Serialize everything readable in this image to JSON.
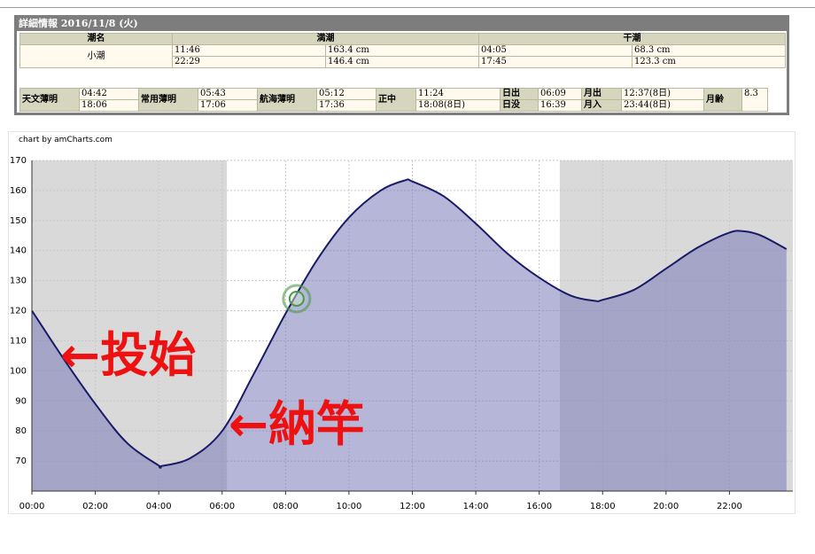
{
  "panel": {
    "title": "詳細情報 2016/11/8 (火)",
    "headers": {
      "name": "潮名",
      "high": "満潮",
      "low": "干潮"
    },
    "tide_name": "小潮",
    "high": [
      {
        "time": "11:46",
        "height": "163.4 cm"
      },
      {
        "time": "22:29",
        "height": "146.4 cm"
      }
    ],
    "low": [
      {
        "time": "04:05",
        "height": "68.3 cm"
      },
      {
        "time": "17:45",
        "height": "123.3 cm"
      }
    ]
  },
  "sun": {
    "astro_label": "天文薄明",
    "astro_start": "04:42",
    "astro_end": "18:06",
    "civil_label": "常用薄明",
    "civil_start": "05:43",
    "civil_end": "17:06",
    "nautical_label": "航海薄明",
    "nautical_start": "05:12",
    "nautical_end": "17:36",
    "noon_label": "正中",
    "noon_time": "11:24",
    "noon_time2": "18:08(8日)",
    "sunrise_label": "日出",
    "sunrise": "06:09",
    "sunset_label": "日没",
    "sunset": "16:39",
    "moonrise_label": "月出",
    "moonrise": "12:37(8日)",
    "moonset_label": "月入",
    "moonset": "23:44(8日)",
    "moonage_label": "月齢",
    "moonage": "8.3"
  },
  "chart_credit": "chart by amCharts.com",
  "annotations": {
    "start": "←投始",
    "end": "←納竿"
  },
  "colors": {
    "night": "#d9d9d9",
    "tide_fill": "#7a7ab8",
    "tide_line": "#1a1a66",
    "annotation": "#ee1111",
    "cursor": "#4a9a4a"
  },
  "chart_data": {
    "type": "area",
    "title": "",
    "xlabel": "",
    "ylabel": "",
    "x_ticks": [
      "00:00",
      "02:00",
      "04:00",
      "06:00",
      "08:00",
      "10:00",
      "12:00",
      "14:00",
      "16:00",
      "18:00",
      "20:00",
      "22:00"
    ],
    "y_ticks": [
      70,
      80,
      90,
      100,
      110,
      120,
      130,
      140,
      150,
      160,
      170
    ],
    "xlim": [
      0,
      24
    ],
    "ylim": [
      60,
      170
    ],
    "series": [
      {
        "x": [
          0,
          1,
          2,
          3,
          4,
          4.083,
          5,
          6,
          7,
          8,
          9,
          10,
          11,
          11.77,
          12,
          13,
          14,
          15,
          16,
          17,
          17.75,
          18,
          19,
          20,
          21,
          22,
          22.48,
          23,
          23.8
        ],
        "values": [
          120,
          104,
          89,
          76,
          68.5,
          68.3,
          71,
          80,
          99,
          119,
          137,
          151,
          160,
          163.4,
          163,
          158,
          149,
          139,
          131,
          125,
          123.3,
          123.6,
          127,
          134,
          141,
          146,
          146.4,
          145,
          140.5
        ]
      }
    ],
    "night_bands": [
      [
        0,
        6.15
      ],
      [
        16.65,
        24
      ]
    ],
    "fishing_start": 1.0,
    "fishing_end": 6.2,
    "cursor": {
      "x": 8.35,
      "y": 124
    },
    "grid": true
  }
}
